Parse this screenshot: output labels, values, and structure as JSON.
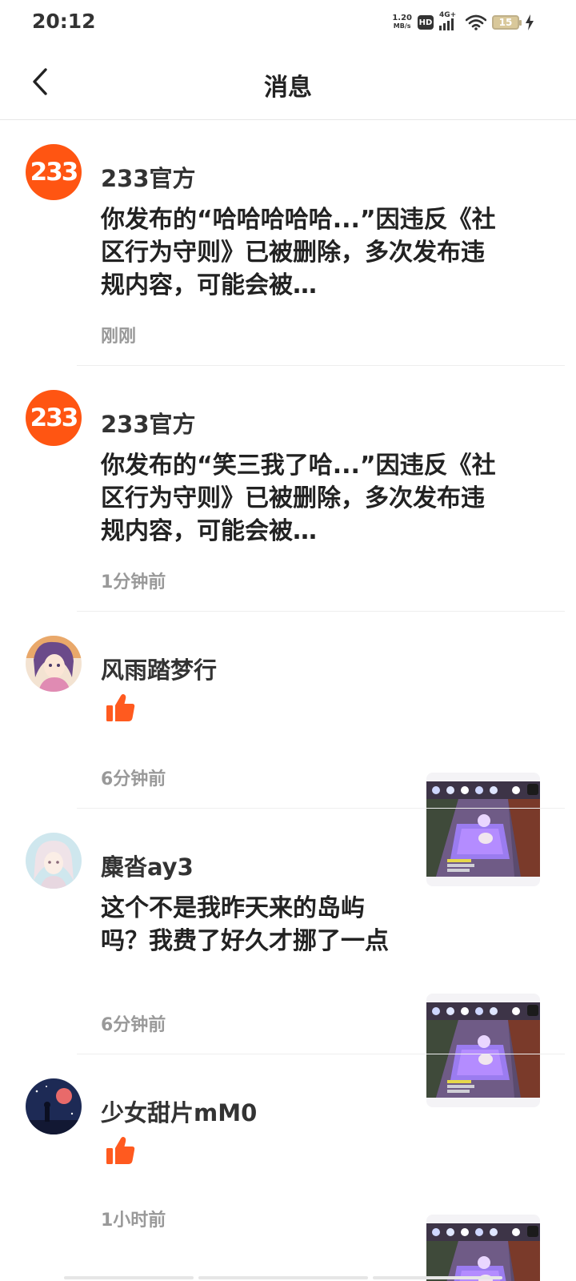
{
  "status_bar": {
    "time": "20:12",
    "net_speed_value": "1.20",
    "net_speed_unit": "MB/s",
    "hd_label": "HD",
    "network_label": "4G+",
    "battery_level": "15"
  },
  "header": {
    "title": "消息"
  },
  "messages": [
    {
      "sender": "233官方",
      "avatar_text": "233",
      "text": "你发布的“哈哈哈哈哈...”因违反《社区行为守则》已被删除，多次发布违规内容，可能会被…",
      "time": "刚刚"
    },
    {
      "sender": "233官方",
      "avatar_text": "233",
      "text": "你发布的“笑三我了哈...”因违反《社区行为守则》已被删除，多次发布违规内容，可能会被…",
      "time": "1分钟前"
    },
    {
      "sender": "风雨踏梦行",
      "type": "like",
      "time": "6分钟前"
    },
    {
      "sender": "麋沓ay3",
      "text": "这个不是我昨天来的岛屿吗？我费了好久才挪了一点",
      "time": "6分钟前"
    },
    {
      "sender": "少女甜片mM0",
      "type": "like",
      "time": "1小时前"
    }
  ],
  "colors": {
    "brand_orange": "#ff5512",
    "like_orange": "#ff5a1f",
    "secondary_text": "#999999"
  }
}
